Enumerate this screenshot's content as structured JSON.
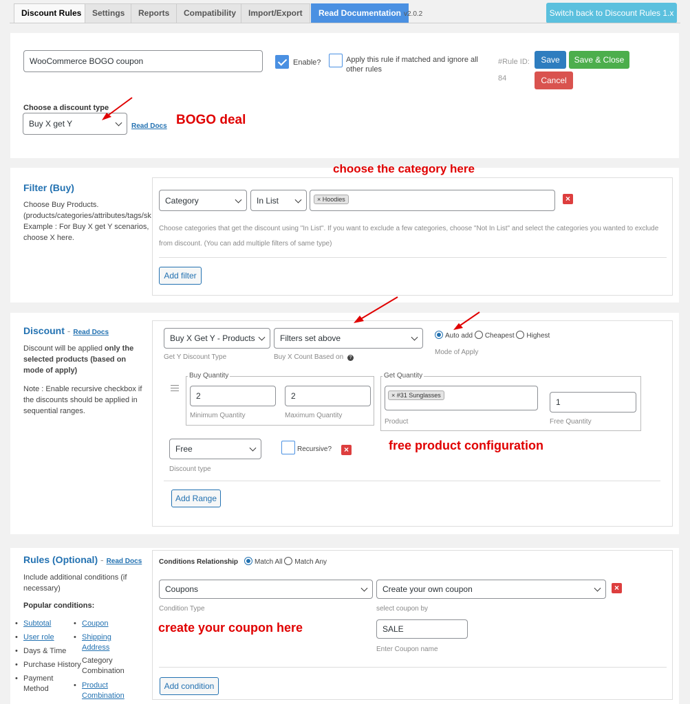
{
  "tabs": [
    {
      "label": "Discount Rules"
    },
    {
      "label": "Settings"
    },
    {
      "label": "Reports"
    },
    {
      "label": "Compatibility"
    },
    {
      "label": "Import/Export"
    },
    {
      "label": "Read Documentation"
    }
  ],
  "version": "v2.0.2",
  "switch_button": "Switch back to Discount Rules 1.x",
  "general": {
    "rule_name": "WooCommerce BOGO coupon",
    "enable_label": "Enable?",
    "apply_label": "Apply this rule if matched and ignore all other rules",
    "rule_id_label": "#Rule ID:",
    "rule_id": "84",
    "save": "Save",
    "save_close": "Save & Close",
    "cancel": "Cancel",
    "discount_type_label": "Choose a discount type",
    "discount_type_value": "Buy X get Y",
    "read_docs": "Read Docs"
  },
  "filter": {
    "title": "Filter (Buy)",
    "desc1": "Choose Buy Products.",
    "desc2": "(products/categories/attributes/tags/sku",
    "desc3": "Example : For Buy X get Y scenarios,",
    "desc4": "choose X here.",
    "field": "Category",
    "operator": "In List",
    "tag": "× Hoodies",
    "help1": "Choose categories that get the discount using \"In List\". If you want to exclude a few categories, choose \"Not In List\" and select the categories you wanted to exclude",
    "help2": "from discount. (You can add multiple filters of same type)",
    "add_filter": "Add filter"
  },
  "discount": {
    "title": "Discount",
    "read_docs": "Read Docs",
    "desc_a": "Discount will be applied ",
    "desc_b": "only the selected products (based on mode of apply)",
    "note": "Note : Enable recursive checkbox if the discounts should be applied in sequential ranges.",
    "get_y_type": "Buy X Get Y - Products",
    "get_y_type_label": "Get Y Discount Type",
    "count_based": "Filters set above",
    "count_based_label": "Buy X Count Based on",
    "mode_auto": "Auto add",
    "mode_cheapest": "Cheapest",
    "mode_highest": "Highest",
    "mode_label": "Mode of Apply",
    "buy_qty_legend": "Buy Quantity",
    "min_qty": "2",
    "min_qty_label": "Minimum Quantity",
    "max_qty": "2",
    "max_qty_label": "Maximum Quantity",
    "get_qty_legend": "Get Quantity",
    "product_tag": "× #31 Sunglasses",
    "product_label": "Product",
    "free_qty": "1",
    "free_qty_label": "Free Quantity",
    "discount_type": "Free",
    "discount_type_label": "Discount type",
    "recursive_label": "Recursive?",
    "add_range": "Add Range"
  },
  "rules": {
    "title": "Rules (Optional)",
    "read_docs": "Read Docs",
    "desc": "Include additional conditions (if necessary)",
    "popular": "Popular conditions:",
    "col1": [
      "Subtotal",
      "User role",
      "Days & Time",
      "Purchase History",
      "Payment Method"
    ],
    "col2": [
      "Coupon",
      "Shipping Address",
      "Category Combination",
      "Product Combination"
    ],
    "relationship_label": "Conditions Relationship",
    "match_all": "Match All",
    "match_any": "Match Any",
    "condition_type": "Coupons",
    "condition_type_label": "Condition Type",
    "coupon_by": "Create your own coupon",
    "coupon_by_label": "select coupon by",
    "coupon_name": "SALE",
    "coupon_name_label": "Enter Coupon name",
    "add_condition": "Add condition"
  },
  "annotations": {
    "bogo": "BOGO deal",
    "category": "choose the category here",
    "free": "free product configuration",
    "coupon": "create your coupon here"
  },
  "colors": {
    "primary": "#2271b1",
    "save": "#2e7dbf",
    "save_close": "#4cae4c",
    "cancel": "#d9534f",
    "switch": "#5bc0de",
    "annotation": "#e00000"
  }
}
